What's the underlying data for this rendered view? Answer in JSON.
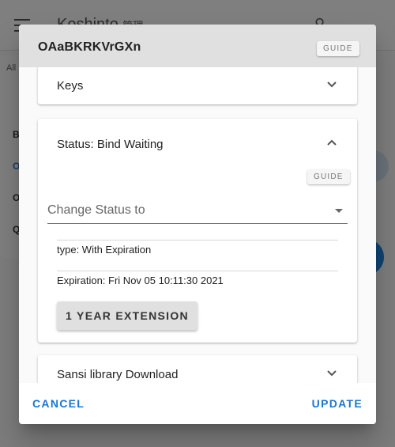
{
  "app": {
    "title": "Koshinto",
    "title_suffix": "管理",
    "filter_label": "All",
    "sidebar_items": [
      "B",
      "O",
      "O",
      "Q"
    ]
  },
  "dialog": {
    "title": "OAaBKRKVrGXn",
    "guide_label": "GUIDE",
    "panels": {
      "keys": {
        "label": "Keys",
        "expanded": false
      },
      "status": {
        "label": "Status: Bind Waiting",
        "expanded": true,
        "guide_label": "GUIDE",
        "change_status_placeholder": "Change Status to",
        "type_text": "type: With Expiration",
        "expiration_text": "Expiration: Fri Nov 05 10:11:30 2021",
        "extension_button": "1 YEAR EXTENSION"
      },
      "download": {
        "label": "Sansi library Download",
        "expanded": false
      }
    },
    "actions": {
      "cancel": "CANCEL",
      "update": "UPDATE"
    }
  },
  "colors": {
    "accent": "#1976d2",
    "header_bg": "#e0e0e0",
    "scrim": "rgba(0,0,0,0.5)"
  },
  "icons": {
    "menu": "menu-icon",
    "expand": "chevron-down-icon",
    "collapse": "chevron-up-icon"
  }
}
